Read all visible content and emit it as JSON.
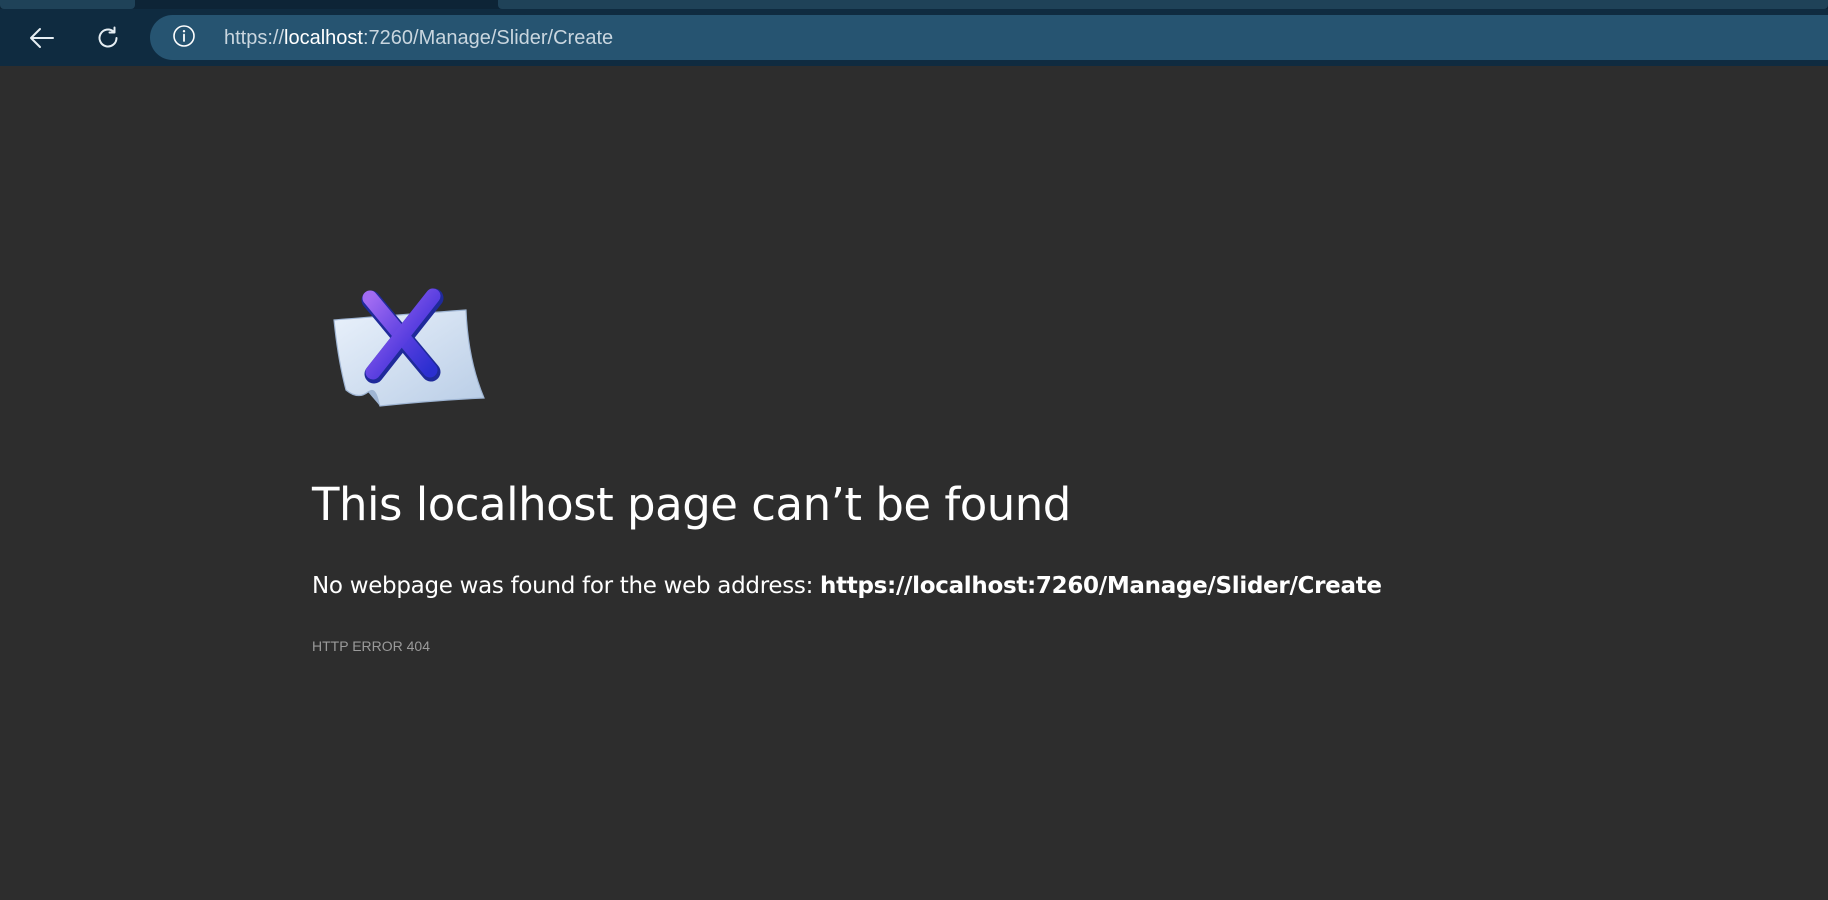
{
  "browser": {
    "url_scheme": "https://",
    "url_host": "localhost",
    "url_path": ":7260/Manage/Slider/Create",
    "icons": {
      "back": "back-arrow-icon",
      "refresh": "refresh-icon",
      "site_info": "info-icon"
    }
  },
  "error_page": {
    "icon": "error-document-icon",
    "title": "This localhost page can’t be found",
    "description_prefix": "No webpage was found for the web address: ",
    "description_address": "https://localhost:7260/Manage/Slider/Create",
    "error_code": "HTTP ERROR 404"
  },
  "colors": {
    "page_background": "#2d2d2d",
    "toolbar_background": "#0f2b40",
    "address_bar_background": "#265471",
    "icon_x_color": "#4b3fd6"
  }
}
